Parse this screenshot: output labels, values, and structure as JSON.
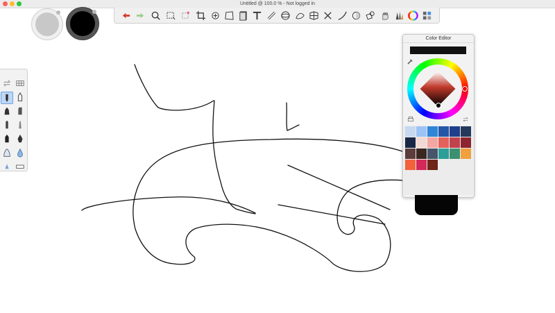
{
  "window": {
    "title": "Untitled @ 100.0 % - Not logged in"
  },
  "traffic_lights": [
    "#ff5f57",
    "#febc2e",
    "#28c840"
  ],
  "brush_colors": {
    "secondary": "#c8c8c8",
    "primary": "#000000"
  },
  "toolbar": {
    "items": [
      "undo-icon",
      "redo-icon",
      "zoom-icon",
      "rect-select-icon",
      "lasso-select-icon",
      "crop-icon",
      "transform-icon",
      "distort-icon",
      "flip-icon",
      "text-icon",
      "ruler-icon",
      "ellipse-guide-icon",
      "french-curve-icon",
      "perspective-icon",
      "symmetry-icon",
      "curve-icon",
      "shape-icon",
      "fill-icon",
      "hand-icon",
      "brush-library-icon",
      "color-wheel-icon",
      "layers-icon"
    ]
  },
  "brush_palette": {
    "items": [
      "swap-icon",
      "grid-icon",
      "pencil-icon",
      "ink-pen-icon",
      "marker-icon",
      "marker-2-icon",
      "felt-pen-icon",
      "chisel-icon",
      "airbrush-icon",
      "spray-icon",
      "blender-icon",
      "water-drop-icon",
      "smudge-icon",
      "eraser-icon"
    ]
  },
  "color_editor": {
    "title": "Color Editor",
    "hex_value": "",
    "selected_color": "#000000",
    "swatches": [
      [
        "#c5d9f1",
        "#9dc3f5",
        "#2f86d8",
        "#2457a8",
        "#1f3f8a",
        "#24395c"
      ],
      [
        "#182746",
        "#f2d9d4",
        "#f4a6a2",
        "#e4625b",
        "#c0434b",
        "#8e2430"
      ],
      [
        "#5d3c3c",
        "#3a2820",
        "#46556b",
        "#2e9e98",
        "#3c9072",
        "#f0a03c"
      ],
      [
        "#f4623c",
        "#d4285a",
        "#6e2416"
      ]
    ]
  }
}
